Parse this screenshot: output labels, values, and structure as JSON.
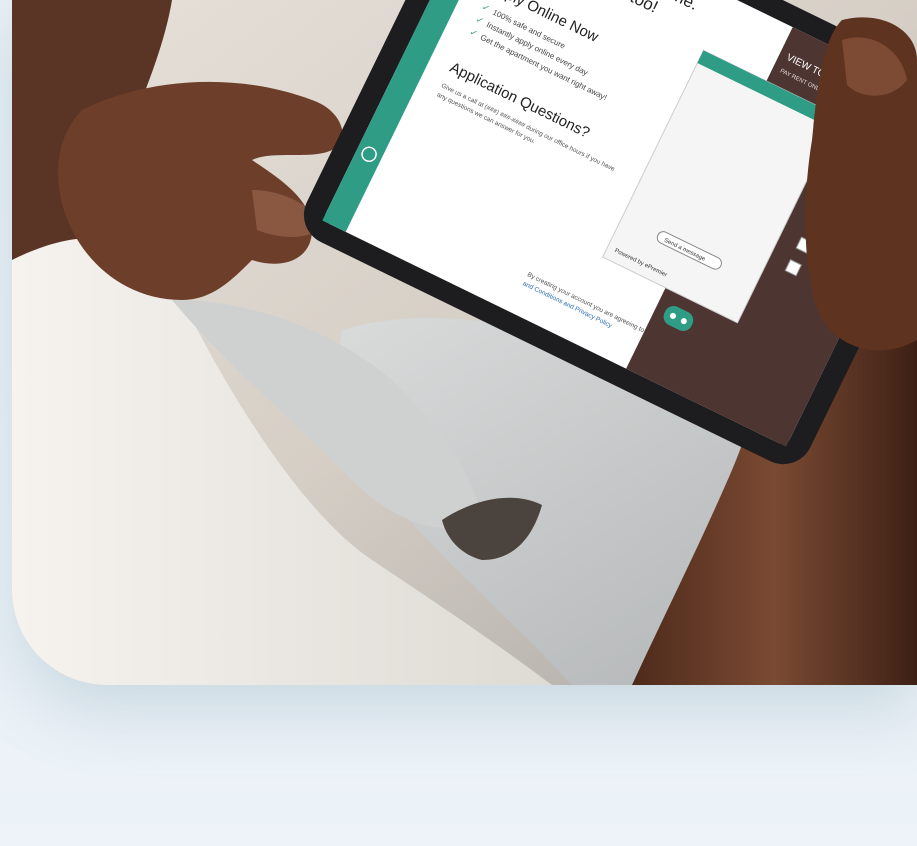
{
  "tablet_screen": {
    "left_panel": {
      "headline_line1": "residents love their home.",
      "headline_line2": "we know you will too!",
      "apply_heading": "Apply Online Now",
      "apply_items": [
        "100% safe and secure",
        "Instantly apply online every day",
        "Get the apartment you want right away!"
      ],
      "questions_heading": "Application Questions?",
      "questions_text_line1": "Give us a call at (###) ###-#### during our office hours if you have",
      "questions_text_line2": "any questions we can answer for you.",
      "consent_line1": "By creating your account you are agreeing to the Terms",
      "consent_line2": "and Conditions and Privacy Policy"
    },
    "right_panel": {
      "app_title": "VIEW TOWERS RESIDENT APP",
      "app_subtitle": "PAY RENT ONLINE | SUBMIT MAINTENANCE REQUESTS |",
      "chat_badge": "Powered by ePremier",
      "chat_button": "Send a message"
    }
  },
  "colors": {
    "tablet_teal": "#2f9c86",
    "tablet_dark_panel": "#4d3532",
    "skin": "#6b3f2a",
    "shirt": "#f0eeea",
    "pants": "#c6c8c8"
  }
}
